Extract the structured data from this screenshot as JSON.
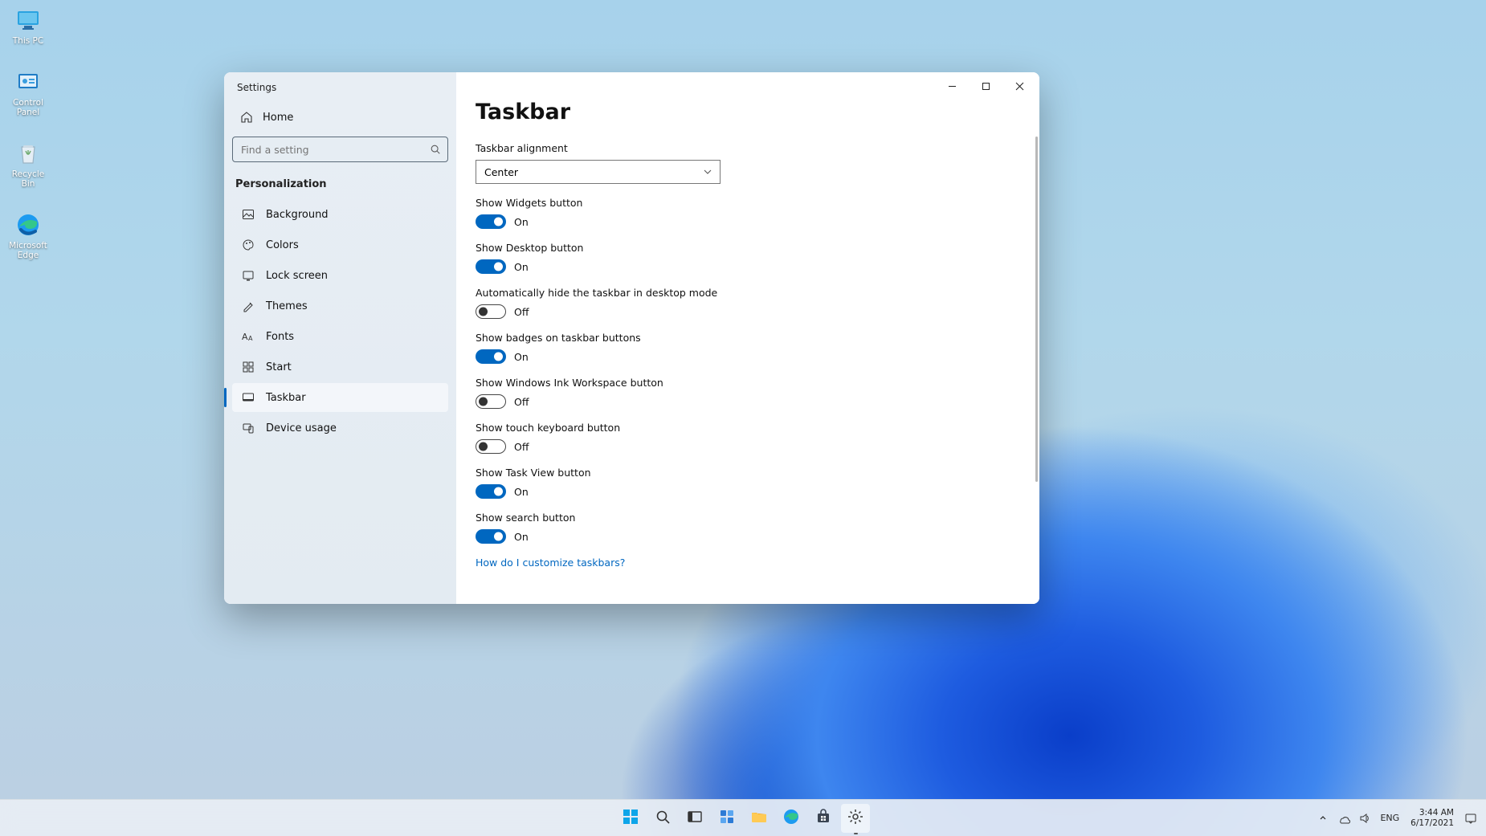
{
  "desktop": {
    "icons": [
      {
        "name": "this-pc",
        "label": "This PC"
      },
      {
        "name": "control-panel",
        "label": "Control Panel"
      },
      {
        "name": "recycle-bin",
        "label": "Recycle Bin"
      },
      {
        "name": "microsoft-edge",
        "label": "Microsoft Edge"
      }
    ]
  },
  "window": {
    "title": "Settings",
    "sidebar": {
      "home_label": "Home",
      "search_placeholder": "Find a setting",
      "section": "Personalization",
      "items": [
        {
          "icon": "background-icon",
          "label": "Background"
        },
        {
          "icon": "colors-icon",
          "label": "Colors"
        },
        {
          "icon": "lockscreen-icon",
          "label": "Lock screen"
        },
        {
          "icon": "themes-icon",
          "label": "Themes"
        },
        {
          "icon": "fonts-icon",
          "label": "Fonts"
        },
        {
          "icon": "start-icon",
          "label": "Start"
        },
        {
          "icon": "taskbar-icon",
          "label": "Taskbar"
        },
        {
          "icon": "device-usage-icon",
          "label": "Device usage"
        }
      ],
      "active_index": 6
    }
  },
  "page": {
    "title": "Taskbar",
    "alignment": {
      "label": "Taskbar alignment",
      "value": "Center"
    },
    "on": "On",
    "off": "Off",
    "toggles": [
      {
        "label": "Show Widgets button",
        "state": true
      },
      {
        "label": "Show Desktop button",
        "state": true
      },
      {
        "label": "Automatically hide the taskbar in desktop mode",
        "state": false
      },
      {
        "label": "Show badges on taskbar buttons",
        "state": true
      },
      {
        "label": "Show Windows Ink Workspace button",
        "state": false
      },
      {
        "label": "Show touch keyboard button",
        "state": false
      },
      {
        "label": "Show Task View button",
        "state": true
      },
      {
        "label": "Show search button",
        "state": true
      }
    ],
    "help_link": "How do I customize taskbars?"
  },
  "taskbar": {
    "apps": [
      {
        "name": "start",
        "icon": "start-logo-icon"
      },
      {
        "name": "search",
        "icon": "search-icon"
      },
      {
        "name": "task-view",
        "icon": "taskview-icon"
      },
      {
        "name": "widgets",
        "icon": "widgets-icon"
      },
      {
        "name": "file-explorer",
        "icon": "folder-icon"
      },
      {
        "name": "edge",
        "icon": "edge-icon"
      },
      {
        "name": "store",
        "icon": "store-icon"
      },
      {
        "name": "settings",
        "icon": "gear-icon"
      }
    ],
    "active_index": 7,
    "tray": {
      "lang": "ENG",
      "time": "3:44 AM",
      "date": "6/17/2021"
    }
  }
}
